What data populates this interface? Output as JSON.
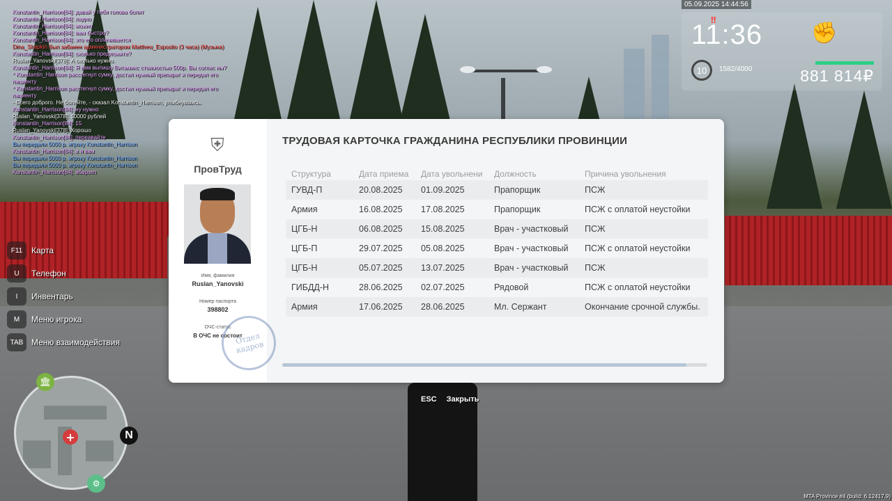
{
  "chat": [
    {
      "text": "Konstantin_Harrison[84]: давай у тебя голова болит",
      "color": "pink"
    },
    {
      "text": "Konstantin_Harrison[84]: ладно",
      "color": "pink"
    },
    {
      "text": "Konstantin_Harrison[84]: можно",
      "color": "pink"
    },
    {
      "text": "Konstantin_Harrison[84]: вам быстро?",
      "color": "pink"
    },
    {
      "text": "Konstantin_Harrison[84]: это его оплачивается",
      "color": "pink"
    },
    {
      "text": "Dina_Shapkin был забанен администратором Matthew_Esposito (3 часа) (Музыка)",
      "color": "red"
    },
    {
      "text": "Konstantin_Harrison[84]: сколько предложите?",
      "color": "pink"
    },
    {
      "text": "Ruslan_Yanovski[378]: А сколько нужно.",
      "color": "white"
    },
    {
      "text": "Konstantin_Harrison[84]: Я вам выпишу Витамикс стоимостью 500р. Вы соглас ны?",
      "color": "pink"
    },
    {
      "text": "* Konstantin_Harrison расстегнул сумку, достал нужный препарат и передал его пациенту",
      "color": "pink"
    },
    {
      "text": "* Konstantin_Harrison расстегнул сумку, достал нужный препарат и передал его пациенту",
      "color": "pink"
    },
    {
      "text": "- Всего доброго. Не болейте, - сказал Konstantin_Harrison, улыбнувшись.",
      "color": "white"
    },
    {
      "text": "Konstantin_Harrison[84]: ну нужно",
      "color": "pink"
    },
    {
      "text": "Ruslan_Yanovski[378]: 10000 рублей",
      "color": "white"
    },
    {
      "text": "Konstantin_Harrison[84]: 15",
      "color": "pink"
    },
    {
      "text": "Ruslan_Yanovski[378]: Хорошо",
      "color": "white"
    },
    {
      "text": "Konstantin_Harrison[84]: переавайте",
      "color": "pink"
    },
    {
      "text": "Вы передали 5000 р. игроку Konstantin_Harrison",
      "color": "blue"
    },
    {
      "text": "Konstantin_Harrison[84]: а я вам",
      "color": "pink"
    },
    {
      "text": "Вы передали 5000 р. игроку Konstantin_Harrison",
      "color": "blue"
    },
    {
      "text": "Вы передали 5000 р. игроку Konstantin_Harrison",
      "color": "blue"
    },
    {
      "text": "Konstantin_Harrison[84]: абарзеп",
      "color": "pink"
    }
  ],
  "keybinds": [
    {
      "key": "F11",
      "label": "Карта"
    },
    {
      "key": "U",
      "label": "Телефон"
    },
    {
      "key": "I",
      "label": "Инвентарь"
    },
    {
      "key": "M",
      "label": "Меню игрока"
    },
    {
      "key": "TAB",
      "label": "Меню взаимодействия"
    }
  ],
  "minimap": {
    "north": "N",
    "icons": [
      "bank-icon",
      "hospital-icon",
      "car-service-icon"
    ]
  },
  "hud": {
    "datetime": "05.09.2025 14:44:56",
    "clock": "11:36",
    "level": "10",
    "exp": "1582/4000",
    "exp_fraction": 0.3955,
    "money": "881 814₽",
    "health_color": "#2ecf84"
  },
  "card": {
    "brand": "ПровТруд",
    "title": "ТРУДОВАЯ КАРТОЧКА ГРАЖДАНИНА РЕСПУБЛИКИ ПРОВИНЦИИ",
    "name_caption": "Имя, фамилия",
    "name": "Ruslan_Yanovski",
    "passport_caption": "Номер паспорта",
    "passport": "398802",
    "och_caption": "ОЧС-статус",
    "och_status": "В ОЧС не состоит",
    "stamp_text": "Отдел кадров",
    "columns": [
      "Структура",
      "Дата приема",
      "Дата увольнени",
      "Должность",
      "Причина увольнения"
    ],
    "rows": [
      [
        "ГУВД-П",
        "20.08.2025",
        "01.09.2025",
        "Прапорщик",
        "ПСЖ"
      ],
      [
        "Армия",
        "16.08.2025",
        "17.08.2025",
        "Прапорщик",
        "ПСЖ с оплатой неустойки"
      ],
      [
        "ЦГБ-Н",
        "06.08.2025",
        "15.08.2025",
        "Врач - участковый",
        "ПСЖ"
      ],
      [
        "ЦГБ-П",
        "29.07.2025",
        "05.08.2025",
        "Врач - участковый",
        "ПСЖ с оплатой неустойки"
      ],
      [
        "ЦГБ-Н",
        "05.07.2025",
        "13.07.2025",
        "Врач - участковый",
        "ПСЖ"
      ],
      [
        "ГИБДД-Н",
        "28.06.2025",
        "02.07.2025",
        "Рядовой",
        "ПСЖ с оплатой неустойки"
      ],
      [
        "Армия",
        "17.06.2025",
        "28.06.2025",
        "Мл. Сержант",
        "Окончание срочной службы."
      ]
    ],
    "scroll_fraction": 0.95
  },
  "esc_hint": {
    "key": "ESC",
    "label": "Закрыть"
  },
  "build": "MTA Province #4 (build: 6.12417.9)"
}
